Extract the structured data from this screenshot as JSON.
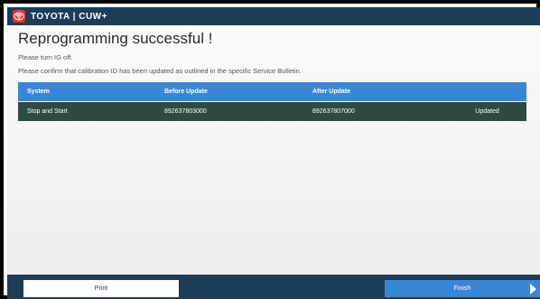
{
  "header": {
    "brand": "TOYOTA | CUW+"
  },
  "main": {
    "title": "Reprogramming successful !",
    "messages": [
      "Please turn IG off.",
      "Please confirm that calibration ID has been updated as outlined in the specific Service Bulletin."
    ],
    "table": {
      "columns": [
        "System",
        "Before Update",
        "After Update",
        ""
      ],
      "rows": [
        [
          "Stop and Start",
          "892637803000",
          "892637807000",
          "Updated"
        ]
      ]
    }
  },
  "footer": {
    "print_label": "Print",
    "finish_label": "Finish"
  },
  "colors": {
    "titlebar": "#1c3d58",
    "table_header": "#3a86d6",
    "table_row": "#2f4a3e",
    "logo": "#e8332a",
    "finish_button": "#3a86d6"
  },
  "icons": {
    "logo": "toyota-logo-icon",
    "finish": "play-arrow-icon"
  }
}
